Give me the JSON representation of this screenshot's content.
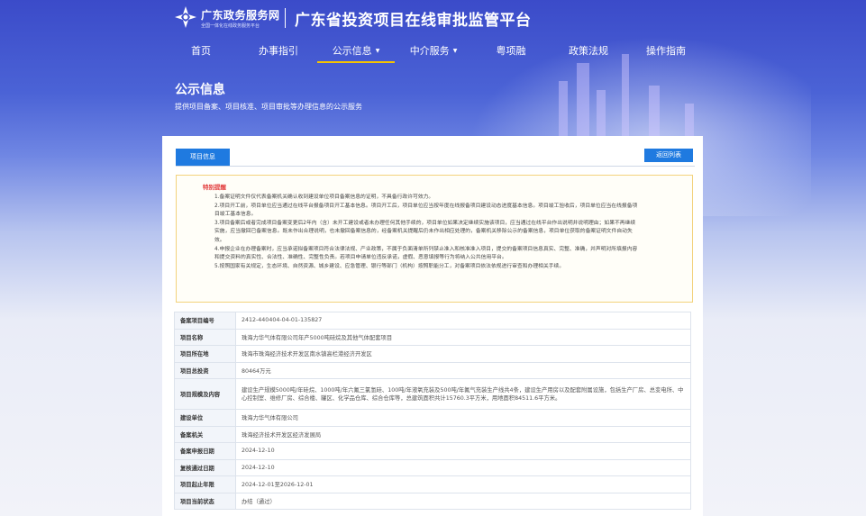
{
  "header": {
    "brand": "广东政务服务网",
    "brand_sub": "全国一体化在线政务服务平台",
    "platform_title": "广东省投资项目在线审批监管平台"
  },
  "nav": [
    {
      "label": "首页",
      "has_caret": false
    },
    {
      "label": "办事指引",
      "has_caret": false
    },
    {
      "label": "公示信息",
      "has_caret": true,
      "active": true
    },
    {
      "label": "中介服务",
      "has_caret": true
    },
    {
      "label": "粤项融",
      "has_caret": false
    },
    {
      "label": "政策法规",
      "has_caret": false
    },
    {
      "label": "操作指南",
      "has_caret": false
    }
  ],
  "page": {
    "title": "公示信息",
    "description": "提供项目备案、项目核准、项目审批等办理信息的公示服务"
  },
  "card": {
    "tab_label": "项目信息",
    "back_label": "返回列表"
  },
  "notice": {
    "title": "特别提醒",
    "items": [
      "1.备案证明文件仅代表备案机关确认收到建设单位项目备案信息的证明，不具备行政许可效力。",
      "2.项目开工前，项目单位应当通过在线平台报备项目开工基本信息。项目开工后，项目单位应当按年度在线报备项目建设动态进度基本信息。项目竣工验收后，项目单位应当在线报备项目竣工基本信息。",
      "3.项目备案后或者完成项目备案变更后2年内（含）未开工建设或者未办理任何其他手续的，项目单位如果决定继续实施该项目，应当通过在线平台作出说明并说明理由；如果不再继续实施，应当撤回已备案信息。既未作出合理说明，也未撤回备案信息的，经备案机关提醒后仍未作出相应处理的，备案机关移除公示的备案信息，项目单位获取的备案证明文件自动失效。",
      "4.申报企业在办理备案时，应当承诺拟备案项目符合法律法规、产业政策，不属于负面清单所列禁止准入和核准准入项目，提交的备案项目信息真实、完整、准确，并声明对所填报内容和提交资料的真实性、合法性、准确性、完整性负责。若项目申请单位违反承诺，虚假、恶意填报等行为将纳入公共信用平台。",
      "5.按照国家有关规定，生态环境、自然资源、城乡建设、应急管理、银行等部门（机构）按照职能分工，对备案项目依法依规进行审查和办理相关手续。"
    ]
  },
  "details": [
    {
      "key": "备案项目编号",
      "value": "2412-440404-04-01-135827"
    },
    {
      "key": "项目名称",
      "value": "珠海力华气体有限公司年产5000吨硅烷及其他气体配套项目"
    },
    {
      "key": "项目所在地",
      "value": "珠海市珠海经济技术开发区南水镇高栏港经济开发区"
    },
    {
      "key": "项目总投资",
      "value": "80464万元"
    },
    {
      "key": "项目规模及内容",
      "value": "建设生产规模5000吨/年硅烷、1000吨/年六氟三氯氢硅、100吨/年液氧充装及500吨/年氟气充装生产线共4条，建设生产用房以及配套附属设施，包括生产厂房、总变电所、中心控制室、维修厂房、综合楼、罐区、化学品仓库、综合仓库等，总建筑面积共计15760.3平方米，用地面积84511.6平方米。",
      "tall": true
    },
    {
      "key": "建设单位",
      "value": "珠海力华气体有限公司"
    },
    {
      "key": "备案机关",
      "value": "珠海经济技术开发区经济发展局"
    },
    {
      "key": "备案申报日期",
      "value": "2024-12-10"
    },
    {
      "key": "复核通过日期",
      "value": "2024-12-10"
    },
    {
      "key": "项目起止年限",
      "value": "2024-12-01至2026-12-01"
    },
    {
      "key": "项目当前状态",
      "value": "办结（通过）"
    }
  ],
  "colors": {
    "primary": "#1f7ae0",
    "nav_active_underline": "#f5c400",
    "notice_title": "#e23b3b",
    "notice_border": "#f3d27c"
  }
}
